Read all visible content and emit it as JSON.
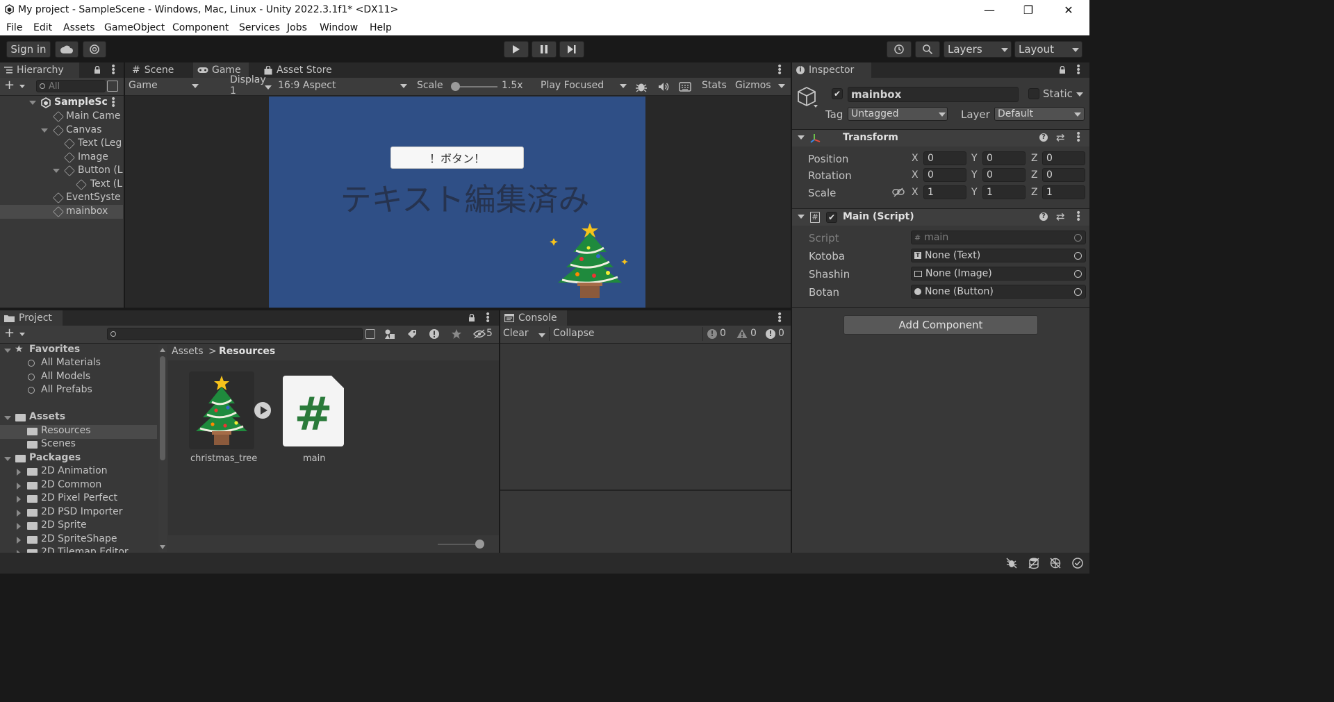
{
  "window": {
    "title": "My project - SampleScene - Windows, Mac, Linux - Unity 2022.3.1f1* <DX11>",
    "minimize": "—",
    "maximize": "❐",
    "close": "✕"
  },
  "menu": [
    "File",
    "Edit",
    "Assets",
    "GameObject",
    "Component",
    "Services",
    "Jobs",
    "Window",
    "Help"
  ],
  "toolbar": {
    "sign_in": "Sign in",
    "layers": "Layers",
    "layout": "Layout"
  },
  "hierarchy": {
    "tab": "Hierarchy",
    "search_placeholder": "All",
    "items": [
      {
        "label": "SampleSc",
        "depth": 0
      },
      {
        "label": "Main Came",
        "depth": 1
      },
      {
        "label": "Canvas",
        "depth": 1
      },
      {
        "label": "Text (Leg",
        "depth": 2
      },
      {
        "label": "Image",
        "depth": 2
      },
      {
        "label": "Button (L",
        "depth": 2
      },
      {
        "label": "Text (L",
        "depth": 3
      },
      {
        "label": "EventSyste",
        "depth": 1
      },
      {
        "label": "mainbox",
        "depth": 1,
        "selected": true
      }
    ]
  },
  "center_tabs": {
    "scene": "Scene",
    "game": "Game",
    "asset_store": "Asset Store"
  },
  "game_bar": {
    "mode": "Game",
    "display": "Display 1",
    "aspect": "16:9 Aspect",
    "scale_label": "Scale",
    "scale_value": "1.5x",
    "play_focused": "Play Focused",
    "stats": "Stats",
    "gizmos": "Gizmos"
  },
  "game_view": {
    "bg_color": "#2f4f86",
    "button_text": "！ボタン！",
    "big_text": "テキスト編集済み"
  },
  "project": {
    "tab": "Project",
    "hidden_count": "5",
    "favorites": {
      "title": "Favorites",
      "items": [
        "All Materials",
        "All Models",
        "All Prefabs"
      ]
    },
    "assets": {
      "title": "Assets",
      "items": [
        "Resources",
        "Scenes"
      ]
    },
    "packages": {
      "title": "Packages",
      "items": [
        "2D Animation",
        "2D Common",
        "2D Pixel Perfect",
        "2D PSD Importer",
        "2D Sprite",
        "2D SpriteShape",
        "2D Tilemap Editor"
      ]
    },
    "breadcrumb": {
      "root": "Assets",
      "current": "Resources"
    },
    "files": [
      {
        "name": "christmas_tree"
      },
      {
        "name": "main"
      }
    ]
  },
  "console": {
    "tab": "Console",
    "clear": "Clear",
    "collapse": "Collapse",
    "count_log": "0",
    "count_warn": "0",
    "count_err": "0"
  },
  "inspector": {
    "tab": "Inspector",
    "object_name": "mainbox",
    "static_label": "Static",
    "tag_label": "Tag",
    "tag_value": "Untagged",
    "layer_label": "Layer",
    "layer_value": "Default",
    "transform": {
      "title": "Transform",
      "rows": [
        {
          "label": "Position",
          "x": "0",
          "y": "0",
          "z": "0"
        },
        {
          "label": "Rotation",
          "x": "0",
          "y": "0",
          "z": "0"
        },
        {
          "label": "Scale",
          "x": "1",
          "y": "1",
          "z": "1"
        }
      ]
    },
    "script": {
      "title": "Main (Script)",
      "script_label": "Script",
      "script_value": "main",
      "fields": [
        {
          "label": "Kotoba",
          "value": "None (Text)"
        },
        {
          "label": "Shashin",
          "value": "None (Image)"
        },
        {
          "label": "Botan",
          "value": "None (Button)"
        }
      ]
    },
    "add_component": "Add Component"
  }
}
